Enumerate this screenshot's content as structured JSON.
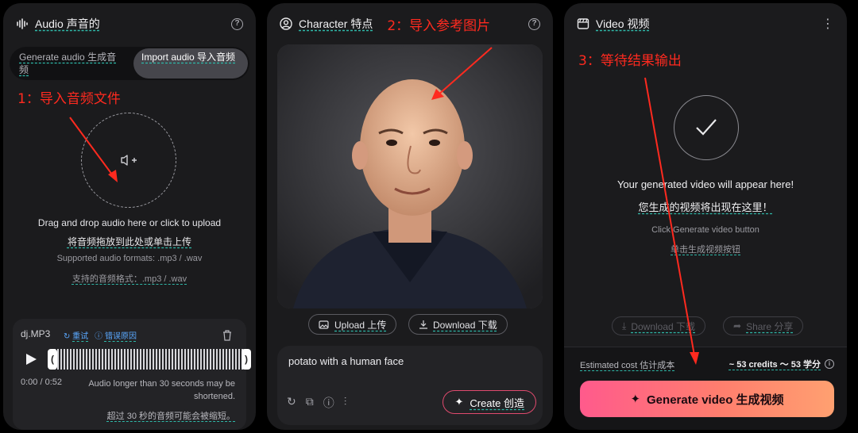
{
  "audio_panel": {
    "title": "Audio 声音的",
    "annotation": "1：导入音频文件",
    "tabs": [
      "Generate audio 生成音频",
      "Import audio 导入音频"
    ],
    "drop_text_en": "Drag and drop audio here or click to upload",
    "drop_text_zh": "将音频拖放到此处或单击上传",
    "formats_en": "Supported audio formats: .mp3 / .wav",
    "formats_zh": "支持的音频格式：.mp3 / .wav",
    "file": {
      "name": "dj.MP3",
      "retry": "重试",
      "error_reason": "错误原因",
      "time": "0:00 / 0:52",
      "warning_en": "Audio longer than 30 seconds may be shortened.",
      "warning_zh": "超过 30 秒的音频可能会被缩短。"
    }
  },
  "character_panel": {
    "title": "Character 特点",
    "annotation": "2：导入参考图片",
    "upload_label": "Upload 上传",
    "download_label": "Download 下载",
    "prompt": "potato with a human face",
    "create_label": "Create 创造"
  },
  "video_panel": {
    "title": "Video 视频",
    "annotation": "3：等待结果输出",
    "appear_en": "Your generated video will appear here!",
    "appear_zh": "您生成的视频将出现在这里！",
    "click_en": "Click Generate video button",
    "click_zh": "单击生成视频按钮",
    "download_label": "Download 下载",
    "share_label": "Share 分享",
    "cost_label": "Estimated cost 估计成本",
    "cost_value": "~ 53 credits ～ 53 学分",
    "generate_label": "Generate video 生成视频"
  },
  "colors": {
    "accent_teal": "#2fb8a8",
    "annotation_red": "#ff2a1f",
    "generate_gradient_start": "#ff5a8c",
    "generate_gradient_end": "#ffa070"
  }
}
